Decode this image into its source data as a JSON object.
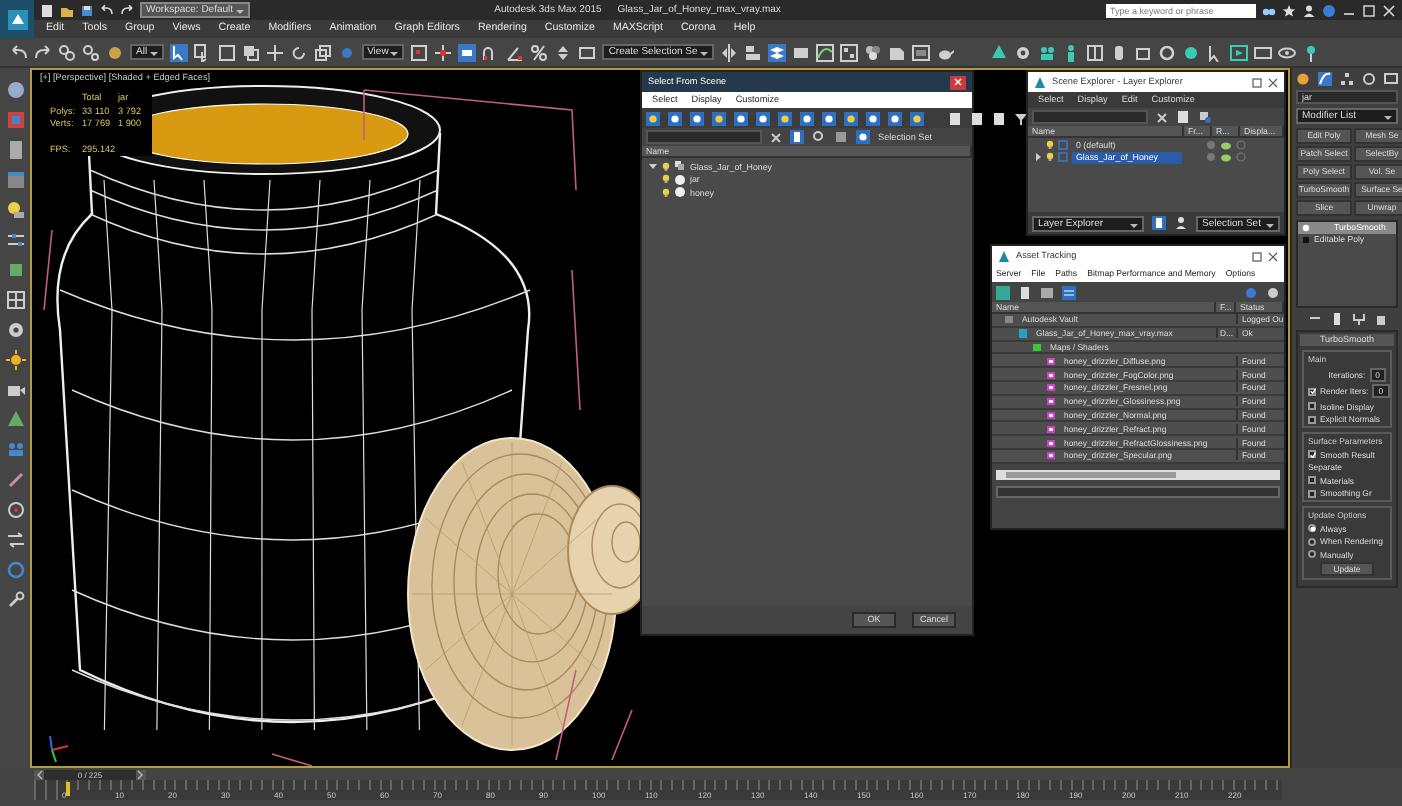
{
  "title_bar": {
    "workspace": "Workspace: Default",
    "app": "Autodesk 3ds Max 2015",
    "file": "Glass_Jar_of_Honey_max_vray.max",
    "search": {
      "placeholder": "Type a keyword or phrase"
    }
  },
  "menu": [
    "Edit",
    "Tools",
    "Group",
    "Views",
    "Create",
    "Modifiers",
    "Animation",
    "Graph Editors",
    "Rendering",
    "Customize",
    "MAXScript",
    "Corona",
    "Help"
  ],
  "toolbar": {
    "selection_filter": "All",
    "reference_coord": "View",
    "named_selection": "Create Selection Se"
  },
  "viewport": {
    "label": "[+] [Perspective] [Shaded + Edged Faces]",
    "stats_headers": [
      "Total",
      "jar"
    ],
    "stats": [
      {
        "label": "Polys:",
        "values": [
          "33 110",
          "3 792"
        ]
      },
      {
        "label": "Verts:",
        "values": [
          "17 769",
          "1 900"
        ]
      }
    ],
    "fps_label": "FPS:",
    "fps": "295.142"
  },
  "select_from_scene": {
    "title": "Select From Scene",
    "menu": [
      "Select",
      "Display",
      "Customize"
    ],
    "selection_set": "Selection Set",
    "column": "Name",
    "tree": [
      {
        "name": "Glass_Jar_of_Honey",
        "expanded": true,
        "children": [
          {
            "name": "jar"
          },
          {
            "name": "honey"
          }
        ]
      }
    ],
    "buttons": [
      "OK",
      "Cancel"
    ]
  },
  "scene_explorer": {
    "title": "Scene Explorer - Layer Explorer",
    "menu": [
      "Select",
      "Display",
      "Edit",
      "Customize"
    ],
    "columns": [
      "Name",
      "Fr...",
      "R...",
      "Displa..."
    ],
    "layers": [
      {
        "name": "0 (default)",
        "selected": false,
        "expandable": false
      },
      {
        "name": "Glass_Jar_of_Honey",
        "selected": true,
        "expandable": true
      }
    ],
    "explorer": "Layer Explorer",
    "selection_set": "Selection Set"
  },
  "asset_tracking": {
    "title": "Asset Tracking",
    "menu": [
      "Server",
      "File",
      "Paths",
      "Bitmap Performance and Memory",
      "Options"
    ],
    "columns": [
      "Name",
      "F...",
      "Status"
    ],
    "rows": [
      {
        "kind": "vault",
        "name": "Autodesk Vault",
        "status": "Logged Ou",
        "children": [
          {
            "kind": "file",
            "name": "Glass_Jar_of_Honey_max_vray.max",
            "flag": "D...",
            "status": "Ok",
            "children": [
              {
                "kind": "folder",
                "name": "Maps / Shaders",
                "children": [
                  {
                    "kind": "image",
                    "name": "honey_drizzler_Diffuse.png",
                    "status": "Found"
                  },
                  {
                    "kind": "image",
                    "name": "honey_drizzler_FogColor.png",
                    "status": "Found"
                  },
                  {
                    "kind": "image",
                    "name": "honey_drizzler_Fresnel.png",
                    "status": "Found"
                  },
                  {
                    "kind": "image",
                    "name": "honey_drizzler_Glossiness.png",
                    "status": "Found"
                  },
                  {
                    "kind": "image",
                    "name": "honey_drizzler_Normal.png",
                    "status": "Found"
                  },
                  {
                    "kind": "image",
                    "name": "honey_drizzler_Refract.png",
                    "status": "Found"
                  },
                  {
                    "kind": "image",
                    "name": "honey_drizzler_RefractGlossiness.png",
                    "status": "Found"
                  },
                  {
                    "kind": "image",
                    "name": "honey_drizzler_Specular.png",
                    "status": "Found"
                  }
                ]
              }
            ]
          }
        ]
      }
    ]
  },
  "command_panel": {
    "object_name": "jar",
    "modifier_list": "Modifier List",
    "modifier_buttons": [
      "Edit Poly",
      "Mesh Se",
      "Patch Select",
      "SelectBy",
      "Poly Select",
      "Vol. Se",
      "TurboSmooth",
      "Surface Se",
      "Slice",
      "Unwrap"
    ],
    "stack": [
      {
        "name": "TurboSmooth",
        "selected": true
      },
      {
        "name": "Editable Poly",
        "selected": false
      }
    ],
    "rollout": {
      "title": "TurboSmooth",
      "groups": [
        {
          "title": "Main",
          "items": [
            {
              "kind": "spinner",
              "label": "Iterations:",
              "value": "0"
            },
            {
              "kind": "check",
              "label": "Render Iters:",
              "checked": true,
              "value": "0"
            },
            {
              "kind": "check",
              "label": "Isoline Display",
              "checked": false
            },
            {
              "kind": "check",
              "label": "Explicit Normals",
              "checked": false
            }
          ]
        },
        {
          "title": "Surface Parameters",
          "items": [
            {
              "kind": "check",
              "label": "Smooth Result",
              "checked": true
            },
            {
              "kind": "text",
              "label": "Separate"
            },
            {
              "kind": "check",
              "label": "Materials",
              "checked": false
            },
            {
              "kind": "check",
              "label": "Smoothing Gr",
              "checked": false
            }
          ]
        },
        {
          "title": "Update Options",
          "items": [
            {
              "kind": "radio",
              "label": "Always",
              "checked": true
            },
            {
              "kind": "radio",
              "label": "When Rendering",
              "checked": false
            },
            {
              "kind": "radio",
              "label": "Manually",
              "checked": false
            },
            {
              "kind": "button",
              "label": "Update"
            }
          ]
        }
      ]
    }
  },
  "timeline": {
    "position": "0 / 225",
    "ticks": [
      "0",
      "10",
      "20",
      "30",
      "40",
      "50",
      "60",
      "70",
      "80",
      "90",
      "100",
      "110",
      "120",
      "130",
      "140",
      "150",
      "160",
      "170",
      "180",
      "190",
      "200",
      "210",
      "220"
    ]
  }
}
